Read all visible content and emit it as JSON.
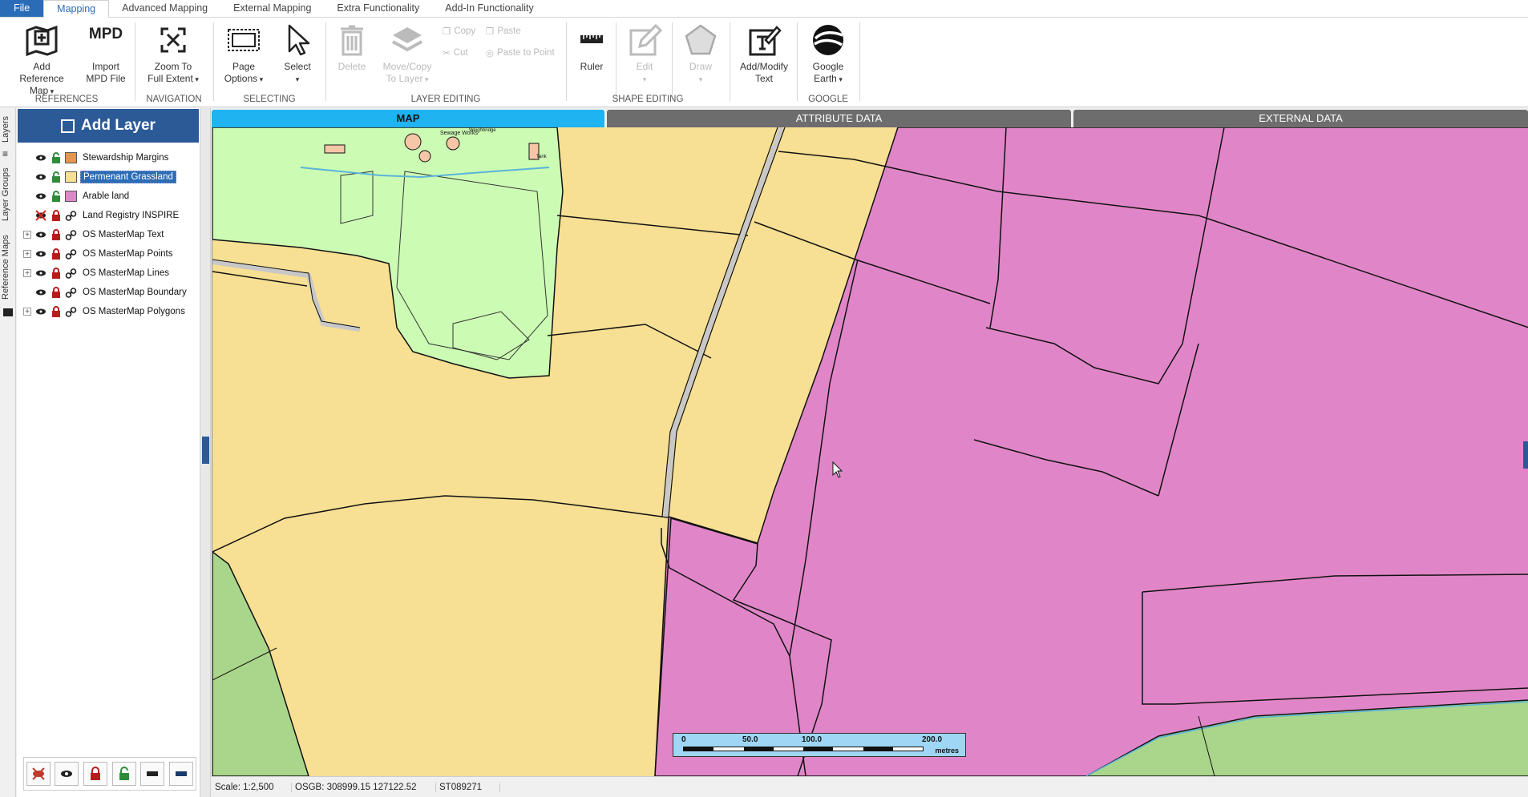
{
  "menu": {
    "file": "File",
    "tabs": [
      "Mapping",
      "Advanced Mapping",
      "External Mapping",
      "Extra Functionality",
      "Add-In Functionality"
    ],
    "active_tab": "Mapping"
  },
  "ribbon": {
    "add_reference": [
      "Add Reference",
      "Map"
    ],
    "import_mpd_icon": "MPD",
    "import_mpd": [
      "Import",
      "MPD File"
    ],
    "references_group": "REFERENCES",
    "zoom_full": [
      "Zoom To",
      "Full Extent"
    ],
    "navigation_group": "NAVIGATION",
    "page_options": [
      "Page",
      "Options"
    ],
    "select": "Select",
    "selecting_group": "SELECTING",
    "delete": "Delete",
    "move_copy": [
      "Move/Copy",
      "To Layer"
    ],
    "copy": "Copy",
    "paste": "Paste",
    "cut": "Cut",
    "paste_to_point": "Paste to Point",
    "layer_editing_group": "LAYER EDITING",
    "ruler": "Ruler",
    "edit": "Edit",
    "draw": "Draw",
    "shape_editing_group": "SHAPE EDITING",
    "add_modify_text": [
      "Add/Modify",
      "Text"
    ],
    "google_earth": [
      "Google",
      "Earth"
    ],
    "google_group": "GOOGLE"
  },
  "side_tabs": [
    "Layers",
    "Layer Groups",
    "Reference Maps"
  ],
  "layer_panel": {
    "add_layer": "Add Layer",
    "layers": [
      {
        "name": "Stewardship Margins",
        "color": "#e8954a",
        "visible": true,
        "locked": false,
        "swatch": true,
        "expandable": false
      },
      {
        "name": "Permenant Grassland",
        "color": "#f7df94",
        "visible": true,
        "locked": false,
        "swatch": true,
        "expandable": false,
        "selected": true
      },
      {
        "name": "Arable land",
        "color": "#e086c8",
        "visible": true,
        "locked": false,
        "swatch": true,
        "expandable": false
      },
      {
        "name": "Land Registry INSPIRE",
        "visible": false,
        "locked": true,
        "swatch": false,
        "expandable": false
      },
      {
        "name": "OS MasterMap Text",
        "visible": true,
        "locked": true,
        "swatch": false,
        "expandable": true
      },
      {
        "name": "OS MasterMap Points",
        "visible": true,
        "locked": true,
        "swatch": false,
        "expandable": true
      },
      {
        "name": "OS MasterMap Lines",
        "visible": true,
        "locked": true,
        "swatch": false,
        "expandable": true
      },
      {
        "name": "OS MasterMap Boundary",
        "visible": true,
        "locked": true,
        "swatch": false,
        "expandable": false
      },
      {
        "name": "OS MasterMap Polygons",
        "visible": true,
        "locked": true,
        "swatch": false,
        "expandable": true
      }
    ]
  },
  "map_tabs": [
    "MAP",
    "ATTRIBUTE DATA",
    "EXTERNAL DATA"
  ],
  "map": {
    "labels": {
      "sewage_works": "Sewage Works",
      "weighbridge": "Weighbridge",
      "tank": "Tank"
    },
    "colors": {
      "grassland": "#f7df94",
      "arable": "#e086c8",
      "green": "#ccfcb4",
      "darkgreen": "#a9d68b",
      "track": "#c8c8c8"
    },
    "scale_ticks": [
      "0",
      "50.0",
      "100.0",
      "200.0"
    ],
    "scale_unit": "metres"
  },
  "status": {
    "scale": "Scale: 1:2,500",
    "coords": "OSGB: 308999.15  127122.52",
    "gridref": "ST089271"
  }
}
